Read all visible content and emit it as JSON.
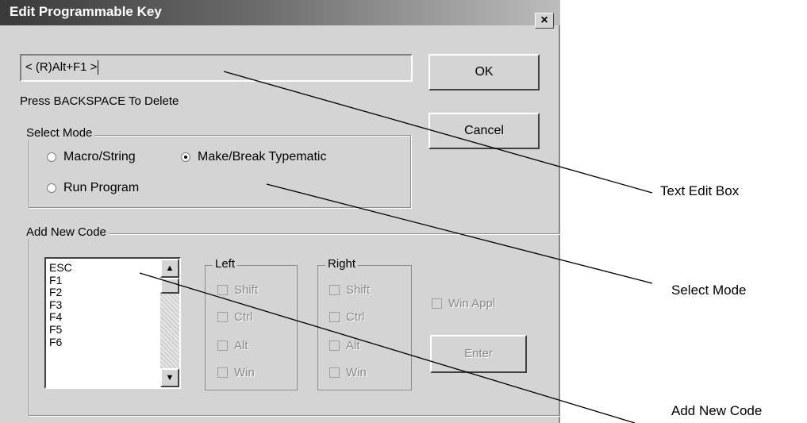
{
  "dialog": {
    "title": "Edit Programmable Key",
    "close_symbol": "×",
    "edit_box_value": "< (R)Alt+F1 >",
    "ok_label": "OK",
    "cancel_label": "Cancel",
    "hint": "Press BACKSPACE To Delete",
    "select_mode": {
      "label": "Select Mode",
      "options": [
        {
          "label": "Macro/String",
          "selected": false
        },
        {
          "label": "Make/Break Typematic",
          "selected": true
        },
        {
          "label": "Run Program",
          "selected": false
        }
      ]
    },
    "add_new_code": {
      "label": "Add New Code",
      "list_items": [
        "ESC",
        "F1",
        "F2",
        "F3",
        "F4",
        "F5",
        "F6"
      ],
      "scroll_up_icon": "▲",
      "scroll_down_icon": "▼",
      "left": {
        "label": "Left",
        "options": [
          "Shift",
          "Ctrl",
          "Alt",
          "Win"
        ]
      },
      "right": {
        "label": "Right",
        "options": [
          "Shift",
          "Ctrl",
          "Alt",
          "Win"
        ]
      },
      "win_appl_label": "Win Appl",
      "enter_label": "Enter"
    }
  },
  "callouts": {
    "text_edit_box": "Text Edit Box",
    "select_mode": "Select Mode",
    "add_new_code": "Add New Code"
  }
}
